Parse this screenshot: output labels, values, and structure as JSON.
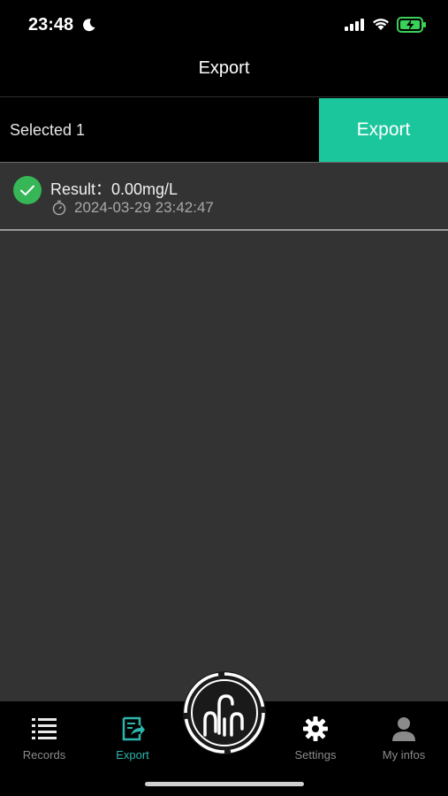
{
  "status_bar": {
    "time": "23:48",
    "icons": [
      "moon-icon",
      "signal-icon",
      "wifi-icon",
      "battery-charging-icon"
    ]
  },
  "header": {
    "title": "Export"
  },
  "selection": {
    "count_label": "Selected 1",
    "export_label": "Export",
    "accent_color": "#1cc69c"
  },
  "records": [
    {
      "result": "Result：0.00mg/L",
      "timestamp": "2024-03-29 23:42:47",
      "selected": true,
      "check_color": "#36b656"
    }
  ],
  "tabs": [
    {
      "label": "Records",
      "icon": "list-icon",
      "active": false
    },
    {
      "label": "Export",
      "icon": "export-icon",
      "active": true
    },
    {
      "label": "Settings",
      "icon": "gear-icon",
      "active": false
    },
    {
      "label": "My infos",
      "icon": "person-icon",
      "active": false
    }
  ],
  "center_button": {
    "icon": "device-logo-icon"
  },
  "active_tab_color": "#2cb6ad"
}
